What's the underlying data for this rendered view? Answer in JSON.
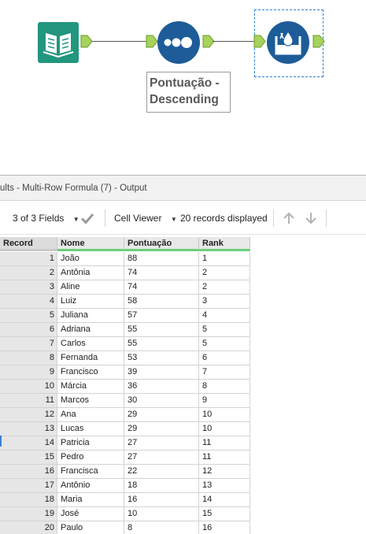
{
  "canvas": {
    "sort_tool_annotation": "Pontuação -\nDescending",
    "colors": {
      "input_tool_bg": "#22967f",
      "sort_tool_bg": "#1d5c98",
      "multirow_tool_bg": "#1d5c98",
      "anchor_fill": "#a6d35b",
      "selection_border": "#2a7fd4"
    },
    "icons": {
      "input_tool": "open-book-icon",
      "sort_tool": "sort-dots-icon",
      "multirow_tool": "multi-row-formula-icon"
    }
  },
  "results": {
    "title": "ults - Multi-Row Formula (7) - Output",
    "toolbar": {
      "fields_selector": "3 of 3 Fields",
      "viewer_selector": "Cell Viewer",
      "records_displayed": "20 records displayed"
    },
    "columns": [
      "Record",
      "Nome",
      "Pontuação",
      "Rank"
    ],
    "rows": [
      {
        "record": "1",
        "nome": "João",
        "pontuacao": "88",
        "rank": "1"
      },
      {
        "record": "2",
        "nome": "Antônia",
        "pontuacao": "74",
        "rank": "2"
      },
      {
        "record": "3",
        "nome": "Aline",
        "pontuacao": "74",
        "rank": "2"
      },
      {
        "record": "4",
        "nome": "Luiz",
        "pontuacao": "58",
        "rank": "3"
      },
      {
        "record": "5",
        "nome": "Juliana",
        "pontuacao": "57",
        "rank": "4"
      },
      {
        "record": "6",
        "nome": "Adriana",
        "pontuacao": "55",
        "rank": "5"
      },
      {
        "record": "7",
        "nome": "Carlos",
        "pontuacao": "55",
        "rank": "5"
      },
      {
        "record": "8",
        "nome": "Fernanda",
        "pontuacao": "53",
        "rank": "6"
      },
      {
        "record": "9",
        "nome": "Francisco",
        "pontuacao": "39",
        "rank": "7"
      },
      {
        "record": "10",
        "nome": "Márcia",
        "pontuacao": "36",
        "rank": "8"
      },
      {
        "record": "11",
        "nome": "Marcos",
        "pontuacao": "30",
        "rank": "9"
      },
      {
        "record": "12",
        "nome": "Ana",
        "pontuacao": "29",
        "rank": "10"
      },
      {
        "record": "13",
        "nome": "Lucas",
        "pontuacao": "29",
        "rank": "10"
      },
      {
        "record": "14",
        "nome": "Patricia",
        "pontuacao": "27",
        "rank": "11"
      },
      {
        "record": "15",
        "nome": "Pedro",
        "pontuacao": "27",
        "rank": "11"
      },
      {
        "record": "16",
        "nome": "Francisca",
        "pontuacao": "22",
        "rank": "12"
      },
      {
        "record": "17",
        "nome": "Antônio",
        "pontuacao": "18",
        "rank": "13"
      },
      {
        "record": "18",
        "nome": "Maria",
        "pontuacao": "16",
        "rank": "14"
      },
      {
        "record": "19",
        "nome": "José",
        "pontuacao": "10",
        "rank": "15"
      },
      {
        "record": "20",
        "nome": "Paulo",
        "pontuacao": "8",
        "rank": "16"
      }
    ]
  }
}
